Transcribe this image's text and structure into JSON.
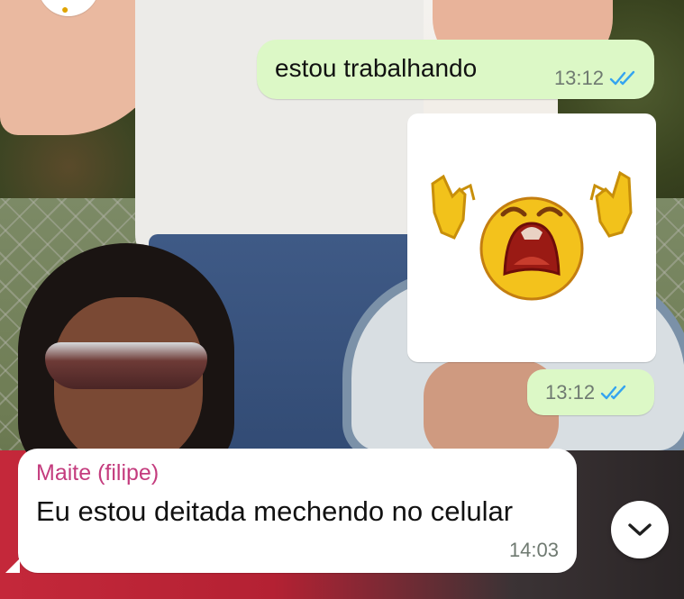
{
  "chat": {
    "messages": [
      {
        "direction": "outgoing",
        "text": "estou trabalhando",
        "time": "13:12",
        "status": "read"
      },
      {
        "direction": "outgoing",
        "type": "sticker",
        "sticker": "crying-emoji-with-raised-hands",
        "time": "13:12",
        "status": "read"
      },
      {
        "direction": "incoming",
        "sender": "Maite (filipe)",
        "text": "Eu estou deitada mechendo no celular",
        "time": "14:03"
      }
    ]
  },
  "colors": {
    "outgoing_bubble": "#dcf8c6",
    "incoming_bubble": "#ffffff",
    "sender_name": "#c43c7e",
    "read_ticks": "#34a4f0",
    "timestamp": "#6f7a71"
  },
  "icons": {
    "read_receipt": "double-check-icon",
    "scroll_down": "chevron-down-icon"
  }
}
